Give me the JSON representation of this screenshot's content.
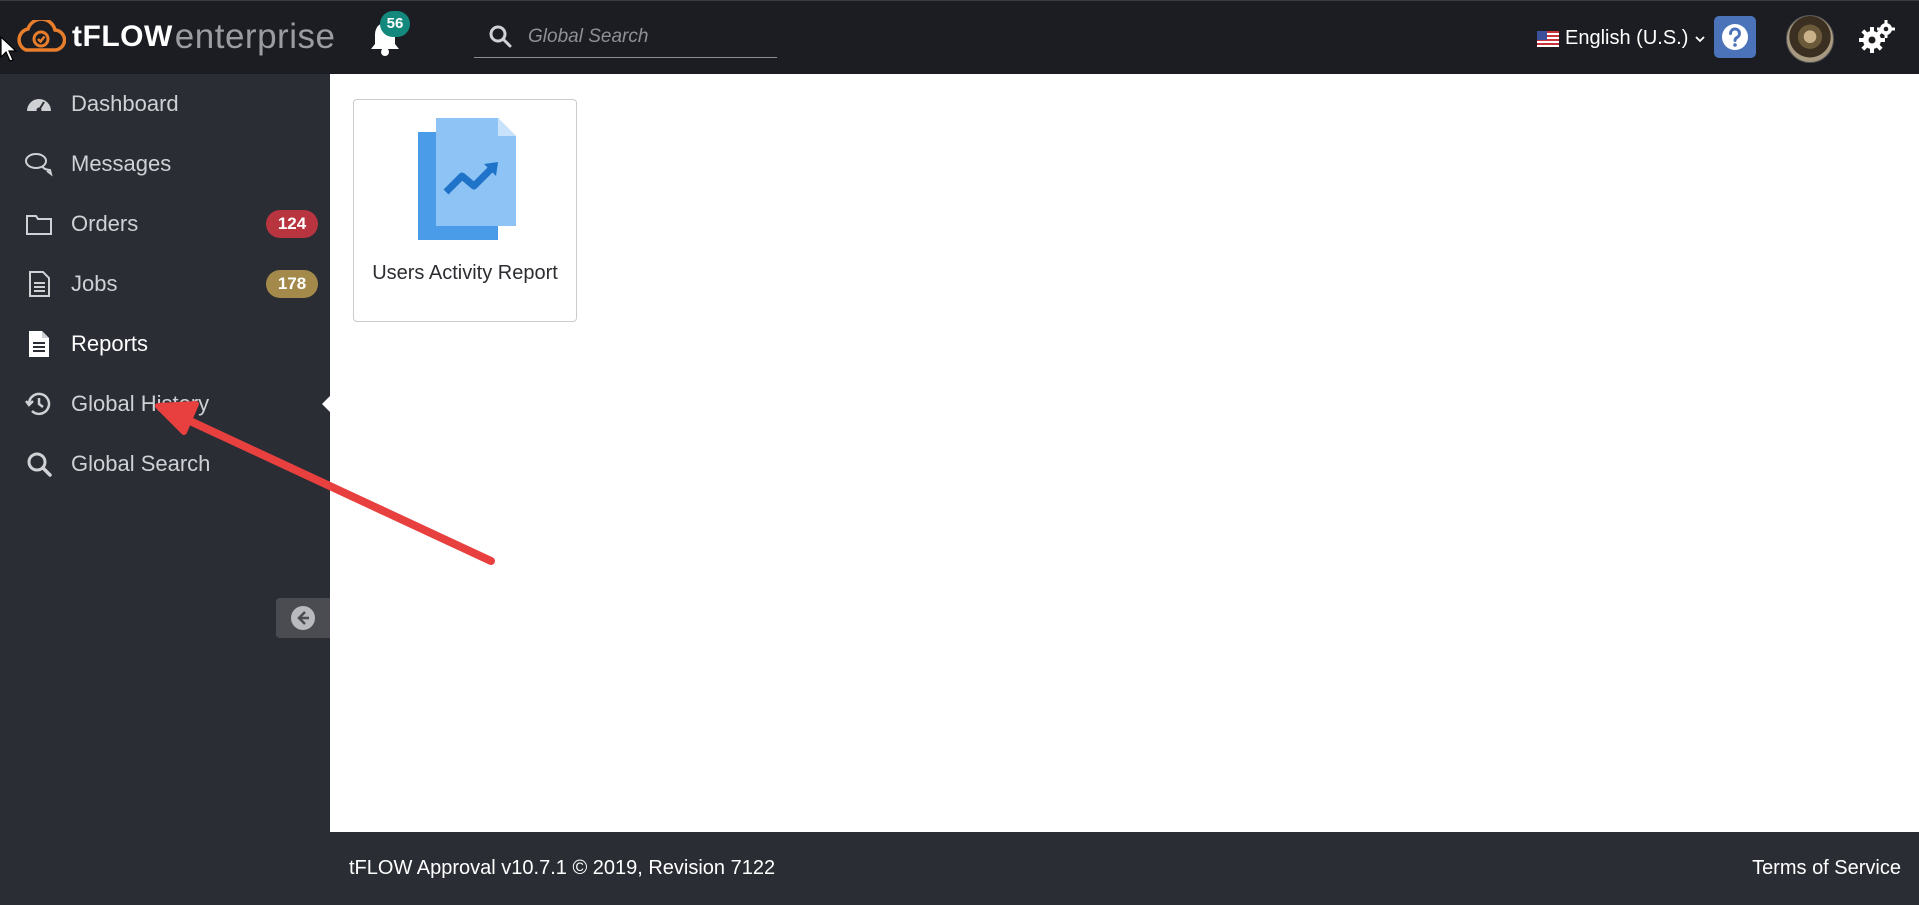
{
  "app": {
    "brand": "tFLOW",
    "edition": "enterprise"
  },
  "header": {
    "notifications_count": "56",
    "search": {
      "placeholder": "Global Search"
    },
    "language": "English (U.S.)",
    "help_icon": "question-circle-icon",
    "settings_icon": "gears-icon"
  },
  "sidebar": {
    "items": [
      {
        "label": "Dashboard",
        "icon": "dashboard-icon"
      },
      {
        "label": "Messages",
        "icon": "messages-icon"
      },
      {
        "label": "Orders",
        "icon": "folder-icon",
        "badge": "124",
        "badge_color": "#b8343f"
      },
      {
        "label": "Jobs",
        "icon": "document-icon",
        "badge": "178",
        "badge_color": "#a48a4a"
      },
      {
        "label": "Reports",
        "icon": "report-icon",
        "active": true
      },
      {
        "label": "Global History",
        "icon": "history-icon"
      },
      {
        "label": "Global Search",
        "icon": "search-icon"
      }
    ]
  },
  "main": {
    "reports": [
      {
        "label": "Users Activity Report",
        "icon": "chart-file-icon"
      }
    ]
  },
  "footer": {
    "version": "tFLOW Approval v10.7.1 © 2019, Revision 7122",
    "terms": "Terms of Service"
  },
  "colors": {
    "topbar": "#1b1d22",
    "sidebar": "#2a2d34",
    "notification_badge": "#13897d",
    "help_button": "#4a73b9",
    "annotation_arrow": "#e8403f",
    "logo_orange": "#e87d2b"
  }
}
